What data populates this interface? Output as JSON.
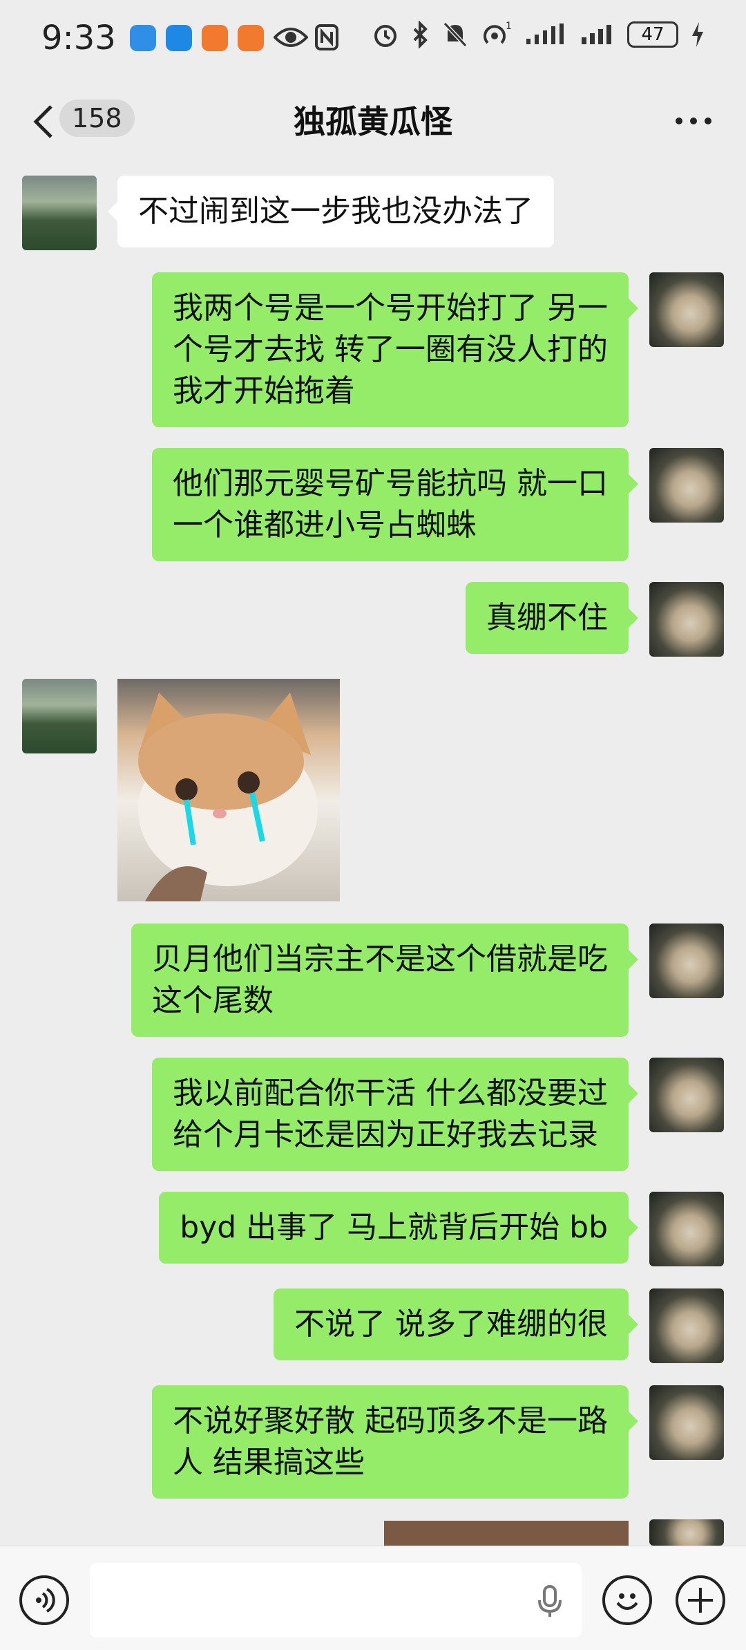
{
  "status_bar": {
    "time": "9:33",
    "signal_superscript": "1",
    "battery": "47"
  },
  "header": {
    "back_count": "158",
    "title": "独孤黄瓜怪"
  },
  "messages": [
    {
      "side": "left",
      "type": "text",
      "text_lines": [
        "不过闹到这一步我也没办法了"
      ]
    },
    {
      "side": "right",
      "type": "text",
      "text_lines": [
        "我两个号是一个号开始打了 另一",
        "个号才去找 转了一圈有没人打的",
        "我才开始拖着"
      ]
    },
    {
      "side": "right",
      "type": "text",
      "text_lines": [
        "他们那元婴号矿号能抗吗 就一口",
        "一个谁都进小号占蜘蛛"
      ]
    },
    {
      "side": "right",
      "type": "text",
      "text_lines": [
        "真绷不住"
      ]
    },
    {
      "side": "left",
      "type": "sticker",
      "icon": "crying-cat-sticker"
    },
    {
      "side": "right",
      "type": "text",
      "text_lines": [
        "贝月他们当宗主不是这个借就是吃",
        "这个尾数"
      ]
    },
    {
      "side": "right",
      "type": "text",
      "text_lines": [
        "我以前配合你干活 什么都没要过",
        "给个月卡还是因为正好我去记录"
      ]
    },
    {
      "side": "right",
      "type": "text",
      "text_lines": [
        "byd 出事了 马上就背后开始 bb"
      ]
    },
    {
      "side": "right",
      "type": "text",
      "text_lines": [
        "不说了 说多了难绷的很"
      ]
    },
    {
      "side": "right",
      "type": "text",
      "text_lines": [
        "不说好聚好散 起码顶多不是一路",
        "人 结果搞这些"
      ]
    },
    {
      "side": "right",
      "type": "image",
      "icon": "photo-thumbnail"
    }
  ],
  "input_bar": {
    "icons": [
      "voice-icon",
      "mic-icon",
      "emoji-icon",
      "plus-icon"
    ]
  },
  "colors": {
    "background": "#ededed",
    "bubble_self": "#95ec69",
    "bubble_other": "#ffffff"
  }
}
